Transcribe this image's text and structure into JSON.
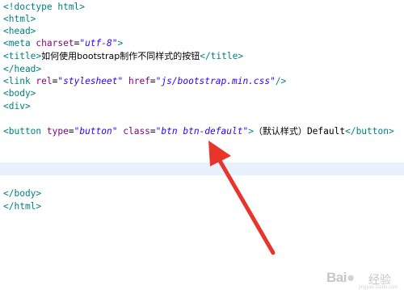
{
  "code_lines": [
    [
      {
        "t": "tag",
        "v": "<!doctype html>"
      }
    ],
    [
      {
        "t": "tag",
        "v": "<html>"
      }
    ],
    [
      {
        "t": "tag",
        "v": "<head>"
      }
    ],
    [
      {
        "t": "tag",
        "v": "<meta "
      },
      {
        "t": "attr",
        "v": "charset"
      },
      {
        "t": "txt",
        "v": "="
      },
      {
        "t": "val",
        "v": "\"utf-8\""
      },
      {
        "t": "tag",
        "v": ">"
      }
    ],
    [
      {
        "t": "tag",
        "v": "<title>"
      },
      {
        "t": "cjk",
        "v": "如何使用bootstrap制作不同样式的按钮"
      },
      {
        "t": "tag",
        "v": "</title>"
      }
    ],
    [
      {
        "t": "tag",
        "v": "</head>"
      }
    ],
    [
      {
        "t": "tag",
        "v": "<link "
      },
      {
        "t": "attr",
        "v": "rel"
      },
      {
        "t": "txt",
        "v": "="
      },
      {
        "t": "val",
        "v": "\"stylesheet\""
      },
      {
        "t": "txt",
        "v": " "
      },
      {
        "t": "attr",
        "v": "href"
      },
      {
        "t": "txt",
        "v": "="
      },
      {
        "t": "val",
        "v": "\"js/bootstrap.min.css\""
      },
      {
        "t": "tag",
        "v": "/>"
      }
    ],
    [
      {
        "t": "tag",
        "v": "<body>"
      }
    ],
    [
      {
        "t": "tag",
        "v": "<div>"
      }
    ],
    [],
    [
      {
        "t": "tag",
        "v": "<button "
      },
      {
        "t": "attr",
        "v": "type"
      },
      {
        "t": "txt",
        "v": "="
      },
      {
        "t": "val",
        "v": "\"button\""
      },
      {
        "t": "txt",
        "v": " "
      },
      {
        "t": "attr",
        "v": "class"
      },
      {
        "t": "txt",
        "v": "="
      },
      {
        "t": "val",
        "v": "\"btn btn-default\""
      },
      {
        "t": "tag",
        "v": ">"
      },
      {
        "t": "cjk",
        "v": "（默认样式）"
      },
      {
        "t": "txt",
        "v": "Default"
      },
      {
        "t": "tag",
        "v": "</button>"
      }
    ],
    [],
    [],
    [],
    [
      {
        "t": "tag",
        "v": "</body>"
      }
    ],
    [
      {
        "t": "tag",
        "v": "</html>"
      }
    ]
  ],
  "line_tops": [
    1,
    16,
    31,
    46,
    62,
    78,
    93,
    108,
    124,
    139,
    155,
    170,
    186,
    201,
    232,
    248
  ],
  "watermark": {
    "logo": "Bai",
    "logo_suffix": "经验",
    "url": "jingyan.baidu.com"
  },
  "colors": {
    "tag": "#008080",
    "attribute": "#7f007f",
    "string": "#2a00ff",
    "current_line": "#e8f2fe",
    "arrow": "#e8352b"
  }
}
